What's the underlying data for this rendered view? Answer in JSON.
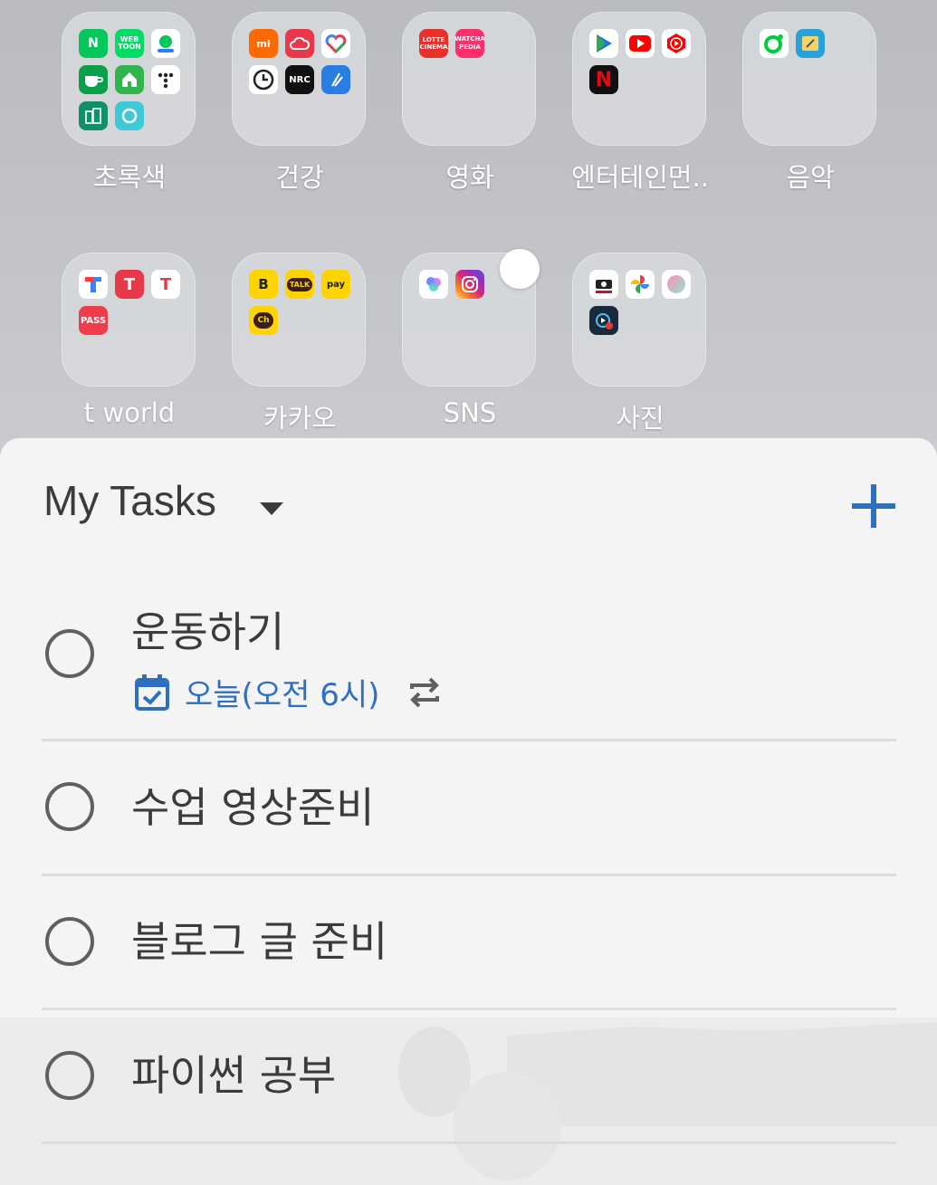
{
  "home": {
    "folders": [
      {
        "label": "초록색",
        "apps": [
          "naver",
          "webtoon",
          "naver-map",
          "cafe",
          "home",
          "dots",
          "building",
          "circle-app"
        ]
      },
      {
        "label": "건강",
        "apps": [
          "mi-fit",
          "cloud-app",
          "health-heart",
          "clock-app",
          "nike-run-club",
          "blue-app"
        ]
      },
      {
        "label": "영화",
        "apps": [
          "lotte-cinema",
          "watcha-pedia"
        ]
      },
      {
        "label": "엔터테인먼..",
        "apps": [
          "play-store",
          "youtube",
          "youtube-music",
          "netflix"
        ]
      },
      {
        "label": "음악",
        "apps": [
          "melon",
          "music-player"
        ]
      },
      {
        "label": "t world",
        "apps": [
          "t-world",
          "t-app",
          "t-shop",
          "pass"
        ]
      },
      {
        "label": "카카오",
        "apps": [
          "kakao-bank",
          "kakao-talk",
          "kakao-pay",
          "kakao-channel"
        ]
      },
      {
        "label": "SNS",
        "apps": [
          "somoim",
          "instagram"
        ]
      },
      {
        "label": "사진",
        "apps": [
          "canon-camera",
          "google-photos",
          "photo-app",
          "video-app"
        ]
      }
    ],
    "mini_texts": {
      "lotte": "LOTTE",
      "cinema": "CINEMA",
      "watcha": "WATCHA",
      "pedia": "PEDIA",
      "nrc": "NRC",
      "talk": "TALK",
      "pay": "pay",
      "pass": "PASS",
      "ch": "Ch",
      "b": "B",
      "n": "N",
      "t": "T",
      "mi": "mi",
      "webtoon": "WEB TOON"
    }
  },
  "widget": {
    "list_title": "My Tasks",
    "tasks": [
      {
        "title": "운동하기",
        "due": "오늘(오전 6시)",
        "repeat": true
      },
      {
        "title": "수업 영상준비"
      },
      {
        "title": "블로그 글 준비"
      },
      {
        "title": "파이썬 공부"
      }
    ]
  },
  "colors": {
    "accent": "#2f6fc0",
    "add_button": "#2f6fc0",
    "text": "#3a3b3d"
  }
}
